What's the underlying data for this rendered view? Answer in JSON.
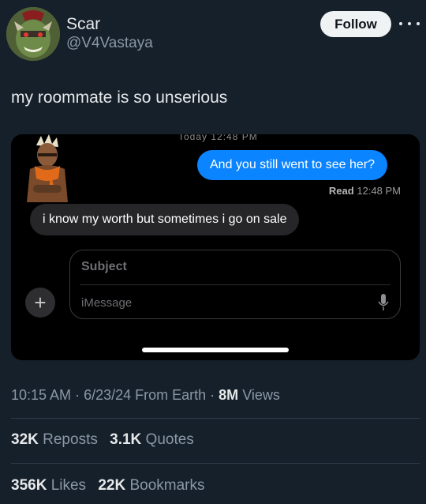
{
  "user": {
    "name": "Scar",
    "handle": "@V4Vastaya",
    "follow_label": "Follow"
  },
  "tweet": {
    "text": "my roommate is so unserious"
  },
  "screenshot": {
    "cutoff_text": "Today 12:48 PM",
    "outgoing_message": "And you still went to see her?",
    "read_label": "Read",
    "read_time": "12:48 PM",
    "incoming_message": "i know my worth but sometimes i go on sale",
    "plus_symbol": "+",
    "subject_placeholder": "Subject",
    "message_placeholder": "iMessage"
  },
  "meta": {
    "time": "10:15 AM",
    "date": "6/23/24",
    "source": "From Earth",
    "views_count": "8M",
    "views_label": "Views"
  },
  "stats": {
    "reposts_count": "32K",
    "reposts_label": "Reposts",
    "quotes_count": "3.1K",
    "quotes_label": "Quotes",
    "likes_count": "356K",
    "likes_label": "Likes",
    "bookmarks_count": "22K",
    "bookmarks_label": "Bookmarks"
  },
  "colors": {
    "background": "#15202b",
    "imessage_blue": "#0b84ff",
    "follow_button": "#eff3f4"
  }
}
